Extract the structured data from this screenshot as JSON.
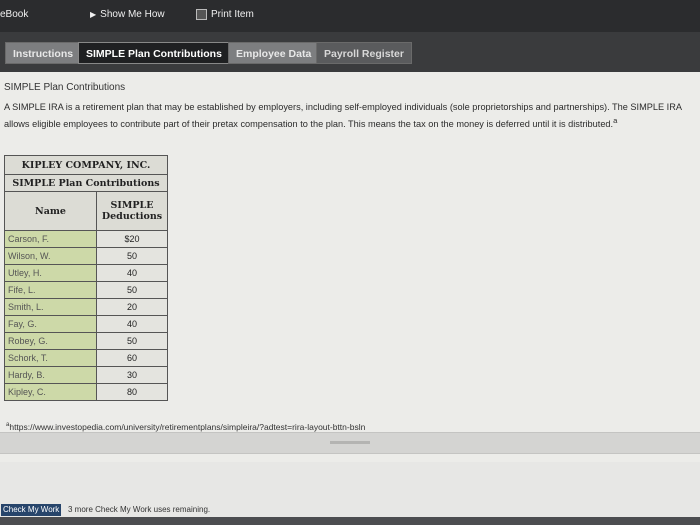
{
  "topbar": {
    "book_label": "eBook",
    "show_me_how_label": "Show Me How",
    "print_item_label": "Print Item"
  },
  "tabs": [
    {
      "label": "Instructions"
    },
    {
      "label": "SIMPLE Plan Contributions"
    },
    {
      "label": "Employee Data"
    },
    {
      "label": "Payroll Register"
    }
  ],
  "section": {
    "title": "SIMPLE Plan Contributions",
    "paragraph": "A SIMPLE IRA is a retirement plan that may be established by employers, including self-employed individuals (sole proprietorships and partnerships). The SIMPLE IRA allows eligible employees to contribute part of their pretax compensation to the plan. This means the tax on the money is deferred until it is distributed.",
    "paragraph_mark": "a"
  },
  "table": {
    "company": "KIPLEY COMPANY, INC.",
    "subtitle": "SIMPLE Plan Contributions",
    "col_name": "Name",
    "col_deduction_line1": "SIMPLE",
    "col_deduction_line2": "Deductions",
    "rows": [
      {
        "name": "Carson, F.",
        "value": "$20"
      },
      {
        "name": "Wilson, W.",
        "value": "50"
      },
      {
        "name": "Utley, H.",
        "value": "40"
      },
      {
        "name": "Fife, L.",
        "value": "50"
      },
      {
        "name": "Smith, L.",
        "value": "20"
      },
      {
        "name": "Fay, G.",
        "value": "40"
      },
      {
        "name": "Robey, G.",
        "value": "50"
      },
      {
        "name": "Schork, T.",
        "value": "60"
      },
      {
        "name": "Hardy, B.",
        "value": "30"
      },
      {
        "name": "Kipley, C.",
        "value": "80"
      }
    ]
  },
  "footnote": {
    "mark": "a",
    "text": "https://www.investopedia.com/university/retirementplans/simpleira/?adtest=rira-layout-bttn-bsln"
  },
  "footer": {
    "check_button": "Check My Work",
    "remaining_text": "3 more Check My Work uses remaining."
  },
  "colors": {
    "topbar": "#2b2c2e",
    "name_cell": "#cdd9a8",
    "check_button": "#27456b"
  }
}
